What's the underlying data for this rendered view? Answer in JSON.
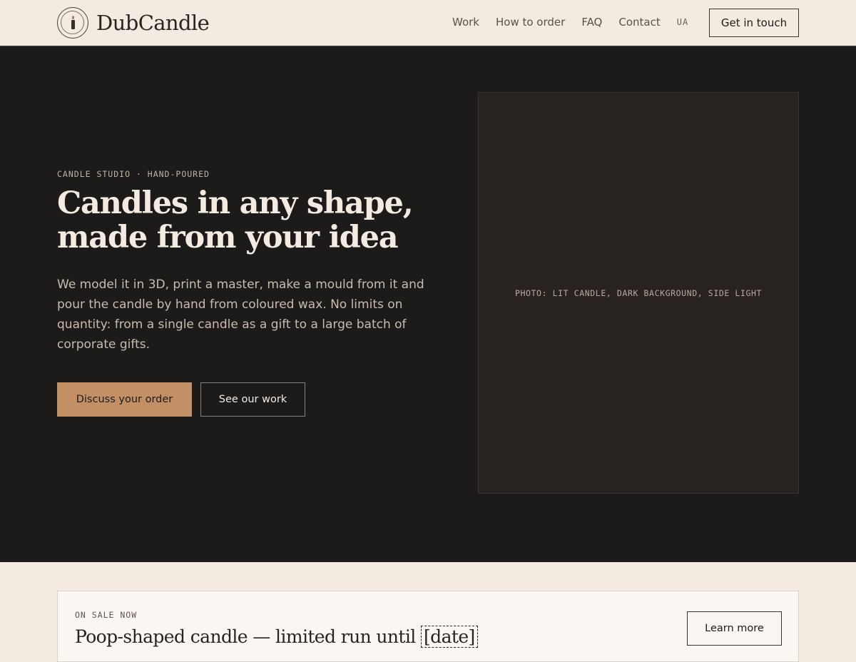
{
  "brand": {
    "name": "DubCandle"
  },
  "nav": {
    "items": [
      {
        "label": "Work"
      },
      {
        "label": "How to order"
      },
      {
        "label": "FAQ"
      },
      {
        "label": "Contact"
      }
    ],
    "language": "UA",
    "cta_label": "Get in touch"
  },
  "hero": {
    "eyebrow": "CANDLE STUDIO · HAND-POURED",
    "title_line1": "Candles in any shape,",
    "title_line2": "made from your idea",
    "description": "We model it in 3D, print a master, make a mould from it and pour the candle by hand from coloured wax. No limits on quantity: from a single candle as a gift to a large batch of corporate gifts.",
    "primary_button": "Discuss your order",
    "secondary_button": "See our work",
    "photo_placeholder": "PHOTO: LIT CANDLE, DARK BACKGROUND, SIDE LIGHT"
  },
  "sale": {
    "eyebrow": "ON SALE NOW",
    "title": "Poop-shaped candle — limited run until",
    "date_placeholder": "[date]",
    "button": "Learn more"
  },
  "colors": {
    "background": "#f3ebe2",
    "hero_background": "#1d1b1a",
    "accent": "#c39065",
    "text_dark": "#2a2420"
  }
}
